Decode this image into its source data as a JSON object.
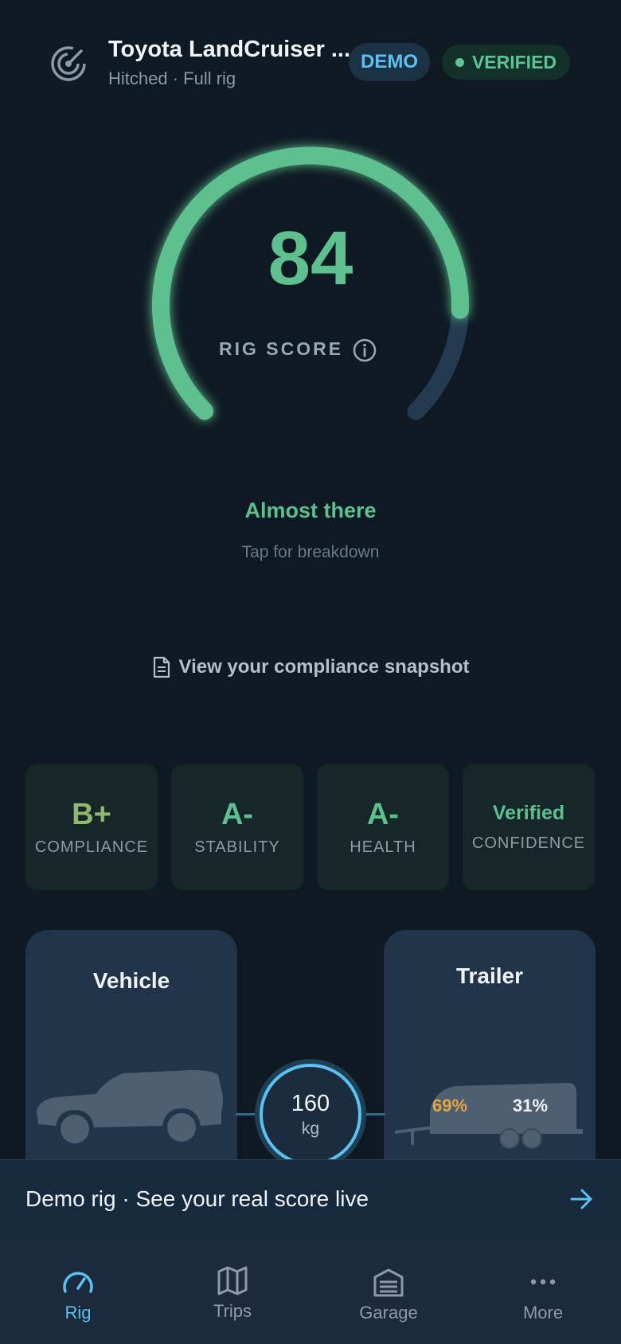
{
  "header": {
    "title": "Toyota LandCruiser ...",
    "subtitle": "Hitched · Full rig",
    "demo_badge": "DEMO",
    "verified_badge": "VERIFIED"
  },
  "score": {
    "value": "84",
    "label": "RIG SCORE",
    "status": "Almost there",
    "hint": "Tap for breakdown"
  },
  "snapshot_link": "View your compliance snapshot",
  "grades": [
    {
      "grade": "B+",
      "label": "COMPLIANCE"
    },
    {
      "grade": "A-",
      "label": "STABILITY"
    },
    {
      "grade": "A-",
      "label": "HEALTH"
    },
    {
      "grade": "Verified",
      "label": "CONFIDENCE"
    }
  ],
  "rig": {
    "vehicle_title": "Vehicle",
    "trailer_title": "Trailer",
    "ball_weight": "160",
    "ball_weight_unit": "kg",
    "trailer_split_left": "69%",
    "trailer_split_right": "31%"
  },
  "banner": {
    "text": "Demo rig · See your real score live"
  },
  "nav": [
    {
      "label": "Rig",
      "icon": "speedometer-icon",
      "active": true
    },
    {
      "label": "Trips",
      "icon": "map-icon",
      "active": false
    },
    {
      "label": "Garage",
      "icon": "garage-icon",
      "active": false
    },
    {
      "label": "More",
      "icon": "more-dots-icon",
      "active": false
    }
  ],
  "colors": {
    "background": "#0f1923",
    "score_green": "#5ec08f",
    "accent_blue": "#5cc0f0",
    "warning_orange": "#e3a63f"
  }
}
